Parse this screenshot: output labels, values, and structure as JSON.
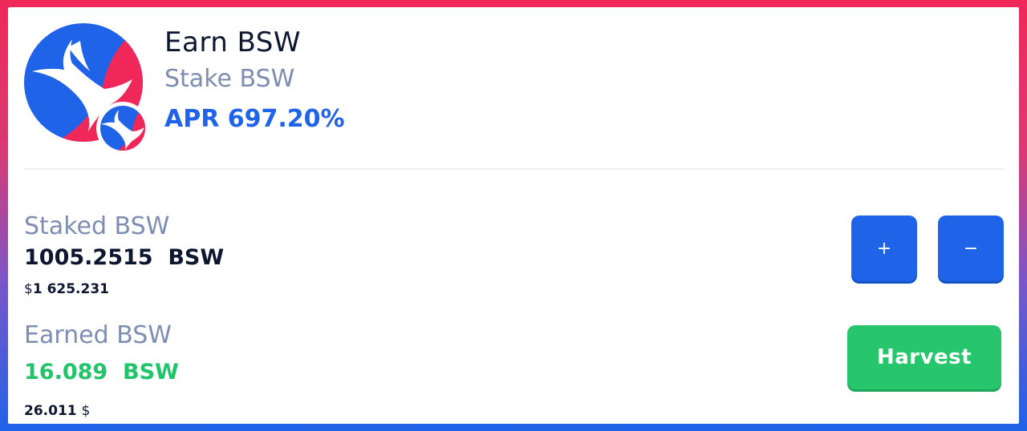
{
  "pool": {
    "title": "Earn BSW",
    "subtitle": "Stake BSW",
    "apr_label": "APR",
    "apr_value": "697.20%"
  },
  "staked": {
    "label": "Staked BSW",
    "amount": "1005.2515  BSW",
    "usd_symbol": "$",
    "usd_value": "1 625.231",
    "increase_label": "+",
    "decrease_label": "−"
  },
  "earned": {
    "label": "Earned BSW",
    "amount": "16.089  BSW",
    "usd_value": "26.011",
    "usd_symbol": "$",
    "harvest_label": "Harvest"
  },
  "colors": {
    "primary_blue": "#1f63e8",
    "accent_red": "#f0285a",
    "earned_green": "#22c46a",
    "muted_text": "#7d8eb2",
    "dark_text": "#0d1730"
  },
  "icons": {
    "pool_logo": "biswap-bird-logo-icon",
    "token_badge": "bsw-token-icon"
  }
}
